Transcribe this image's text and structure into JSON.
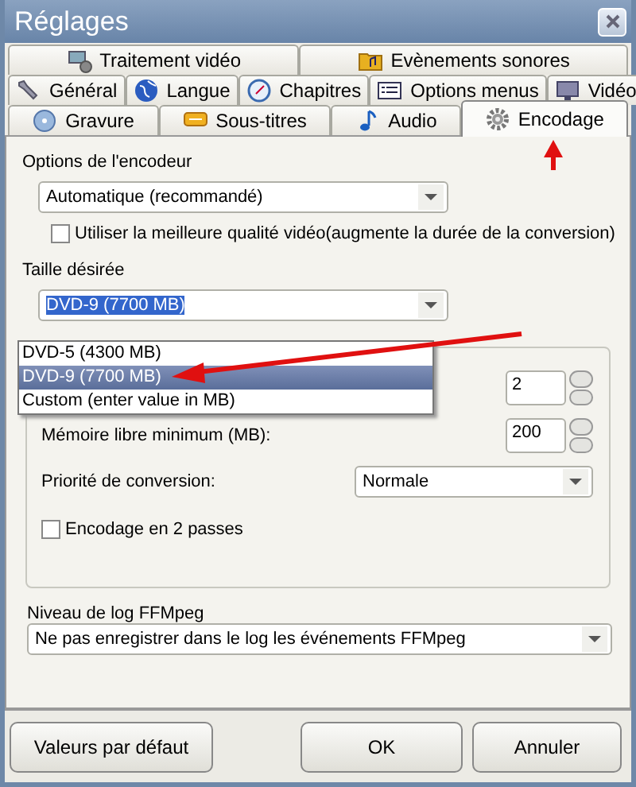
{
  "window": {
    "title": "Réglages"
  },
  "tab_rows": [
    [
      {
        "label": "Traitement vidéo",
        "selected": false
      },
      {
        "label": "Evènements sonores",
        "selected": false
      }
    ],
    [
      {
        "label": "Général",
        "selected": false
      },
      {
        "label": "Langue",
        "selected": false
      },
      {
        "label": "Chapitres",
        "selected": false
      },
      {
        "label": "Options menus",
        "selected": false
      },
      {
        "label": "Vidéo",
        "selected": false
      }
    ],
    [
      {
        "label": "Gravure",
        "selected": false
      },
      {
        "label": "Sous-titres",
        "selected": false
      },
      {
        "label": "Audio",
        "selected": false
      },
      {
        "label": "Encodage",
        "selected": true
      }
    ]
  ],
  "encoder": {
    "label": "Options de l'encodeur",
    "value": "Automatique (recommandé)",
    "checkbox": {
      "label": "Utiliser la meilleure qualité vidéo(augmente la durée de la conversion)",
      "checked": false
    }
  },
  "size": {
    "label": "Taille désirée",
    "value": "DVD-9 (7700 MB)",
    "options": [
      {
        "label": "DVD-5 (4300 MB)",
        "selected": false
      },
      {
        "label": "DVD-9 (7700 MB)",
        "selected": true
      },
      {
        "label": "Custom (enter value in MB)",
        "selected": false
      }
    ]
  },
  "group": {
    "spinners": [
      {
        "value": "2"
      },
      {
        "label": "Mémoire libre minimum (MB):",
        "value": "200"
      }
    ],
    "priority": {
      "label": "Priorité de conversion:",
      "value": "Normale"
    },
    "two_pass": {
      "label": "Encodage en 2 passes",
      "checked": false
    }
  },
  "log": {
    "label": "Niveau de log FFMpeg",
    "value": "Ne pas enregistrer dans le log les événements FFMpeg"
  },
  "buttons": [
    {
      "label": "Valeurs par défaut"
    },
    {
      "label": "OK"
    },
    {
      "label": "Annuler"
    }
  ]
}
